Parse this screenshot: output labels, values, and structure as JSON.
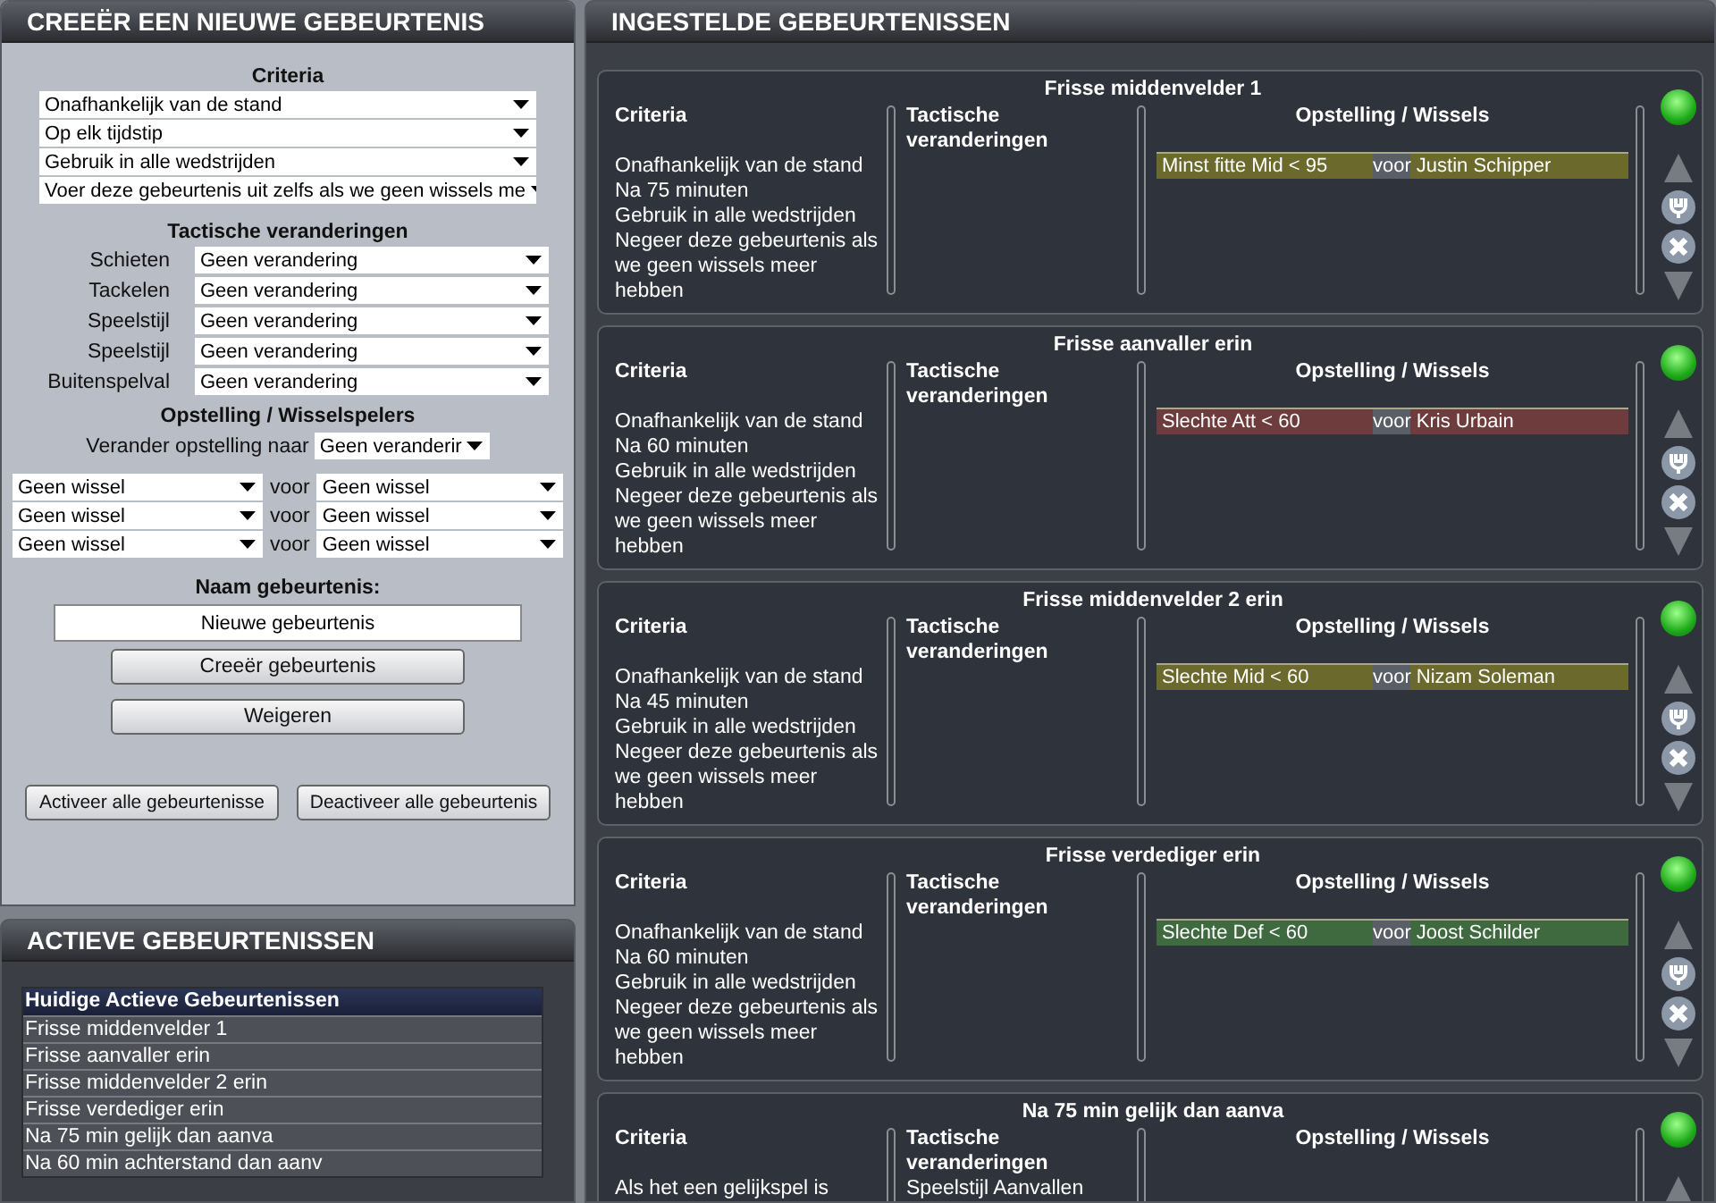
{
  "create_panel": {
    "title": "CREEËR EEN NIEUWE GEBEURTENIS",
    "criteria_heading": "Criteria",
    "criteria": [
      "Onafhankelijk van de stand",
      "Op elk tijdstip",
      "Gebruik in alle wedstrijden",
      "Voer deze gebeurtenis uit zelfs als we geen wissels me"
    ],
    "tactics_heading": "Tactische veranderingen",
    "tactics": [
      {
        "label": "Schieten",
        "value": "Geen verandering"
      },
      {
        "label": "Tackelen",
        "value": "Geen verandering"
      },
      {
        "label": "Speelstijl",
        "value": "Geen verandering"
      },
      {
        "label": "Speelstijl",
        "value": "Geen verandering"
      },
      {
        "label": "Buitenspelval",
        "value": "Geen verandering"
      }
    ],
    "lineup_heading": "Opstelling / Wisselspelers",
    "formation_label": "Verander opstelling naar",
    "formation_value": "Geen veranderir",
    "substitutions": [
      {
        "out": "Geen wissel",
        "link": "voor",
        "in": "Geen wissel"
      },
      {
        "out": "Geen wissel",
        "link": "voor",
        "in": "Geen wissel"
      },
      {
        "out": "Geen wissel",
        "link": "voor",
        "in": "Geen wissel"
      }
    ],
    "name_label": "Naam gebeurtenis:",
    "name_value": "Nieuwe gebeurtenis",
    "buttons": [
      "Creeër gebeurtenis",
      "Weigeren"
    ],
    "bulk_buttons": [
      "Activeer alle gebeurtenisse",
      "Deactiveer alle gebeurtenis"
    ]
  },
  "active_panel": {
    "title": "ACTIEVE GEBEURTENISSEN",
    "list_header": "Huidige Actieve Gebeurtenissen",
    "items": [
      "Frisse middenvelder 1",
      "Frisse aanvaller erin",
      "Frisse middenvelder 2 erin",
      "Frisse verdediger erin",
      "Na 75 min gelijk dan aanva",
      "Na 60 min achterstand dan aanv"
    ]
  },
  "events_panel": {
    "title": "INGESTELDE GEBEURTENISSEN",
    "events": [
      {
        "title": "Frisse middenvelder 1",
        "active": true,
        "criteria_heading": "Criteria",
        "criteria": [
          "Onafhankelijk van de stand",
          "Na 75 minuten",
          "Gebruik in alle wedstrijden",
          "Negeer deze gebeurtenis als we geen wissels meer hebben"
        ],
        "tactics_heading": "Tactische veranderingen",
        "lineup_heading": "Opstelling / Wissels",
        "substitutions": [
          {
            "out": "Minst fitte Mid < 95",
            "link": "voor",
            "in": "Justin Schipper",
            "color": "#6b6a2c"
          }
        ]
      },
      {
        "title": "Frisse aanvaller erin",
        "active": true,
        "criteria_heading": "Criteria",
        "criteria": [
          "Onafhankelijk van de stand",
          "Na 60 minuten",
          "Gebruik in alle wedstrijden",
          "Negeer deze gebeurtenis als we geen wissels meer hebben"
        ],
        "tactics_heading": "Tactische veranderingen",
        "lineup_heading": "Opstelling / Wissels",
        "substitutions": [
          {
            "out": "Slechte Att < 60",
            "link": "voor",
            "in": "Kris Urbain",
            "color": "#6e3c3c"
          }
        ]
      },
      {
        "title": "Frisse middenvelder 2 erin",
        "active": true,
        "criteria_heading": "Criteria",
        "criteria": [
          "Onafhankelijk van de stand",
          "Na 45 minuten",
          "Gebruik in alle wedstrijden",
          "Negeer deze gebeurtenis als we geen wissels meer hebben"
        ],
        "tactics_heading": "Tactische veranderingen",
        "lineup_heading": "Opstelling / Wissels",
        "substitutions": [
          {
            "out": "Slechte Mid < 60",
            "link": "voor",
            "in": "Nizam Soleman",
            "color": "#6b6a2c"
          }
        ]
      },
      {
        "title": "Frisse verdediger erin",
        "active": true,
        "criteria_heading": "Criteria",
        "criteria": [
          "Onafhankelijk van de stand",
          "Na 60 minuten",
          "Gebruik in alle wedstrijden",
          "Negeer deze gebeurtenis als we geen wissels meer hebben"
        ],
        "tactics_heading": "Tactische veranderingen",
        "lineup_heading": "Opstelling / Wissels",
        "substitutions": [
          {
            "out": "Slechte Def < 60",
            "link": "voor",
            "in": "Joost Schilder",
            "color": "#3f6a40"
          }
        ]
      },
      {
        "title": "Na 75 min gelijk dan aanva",
        "active": true,
        "criteria_heading": "Criteria",
        "criteria": [
          "Als het een gelijkspel is"
        ],
        "tactics_heading": "Tactische veranderingen",
        "tactics": [
          "Speelstijl Aanvallen"
        ],
        "lineup_heading": "Opstelling / Wissels"
      }
    ]
  }
}
